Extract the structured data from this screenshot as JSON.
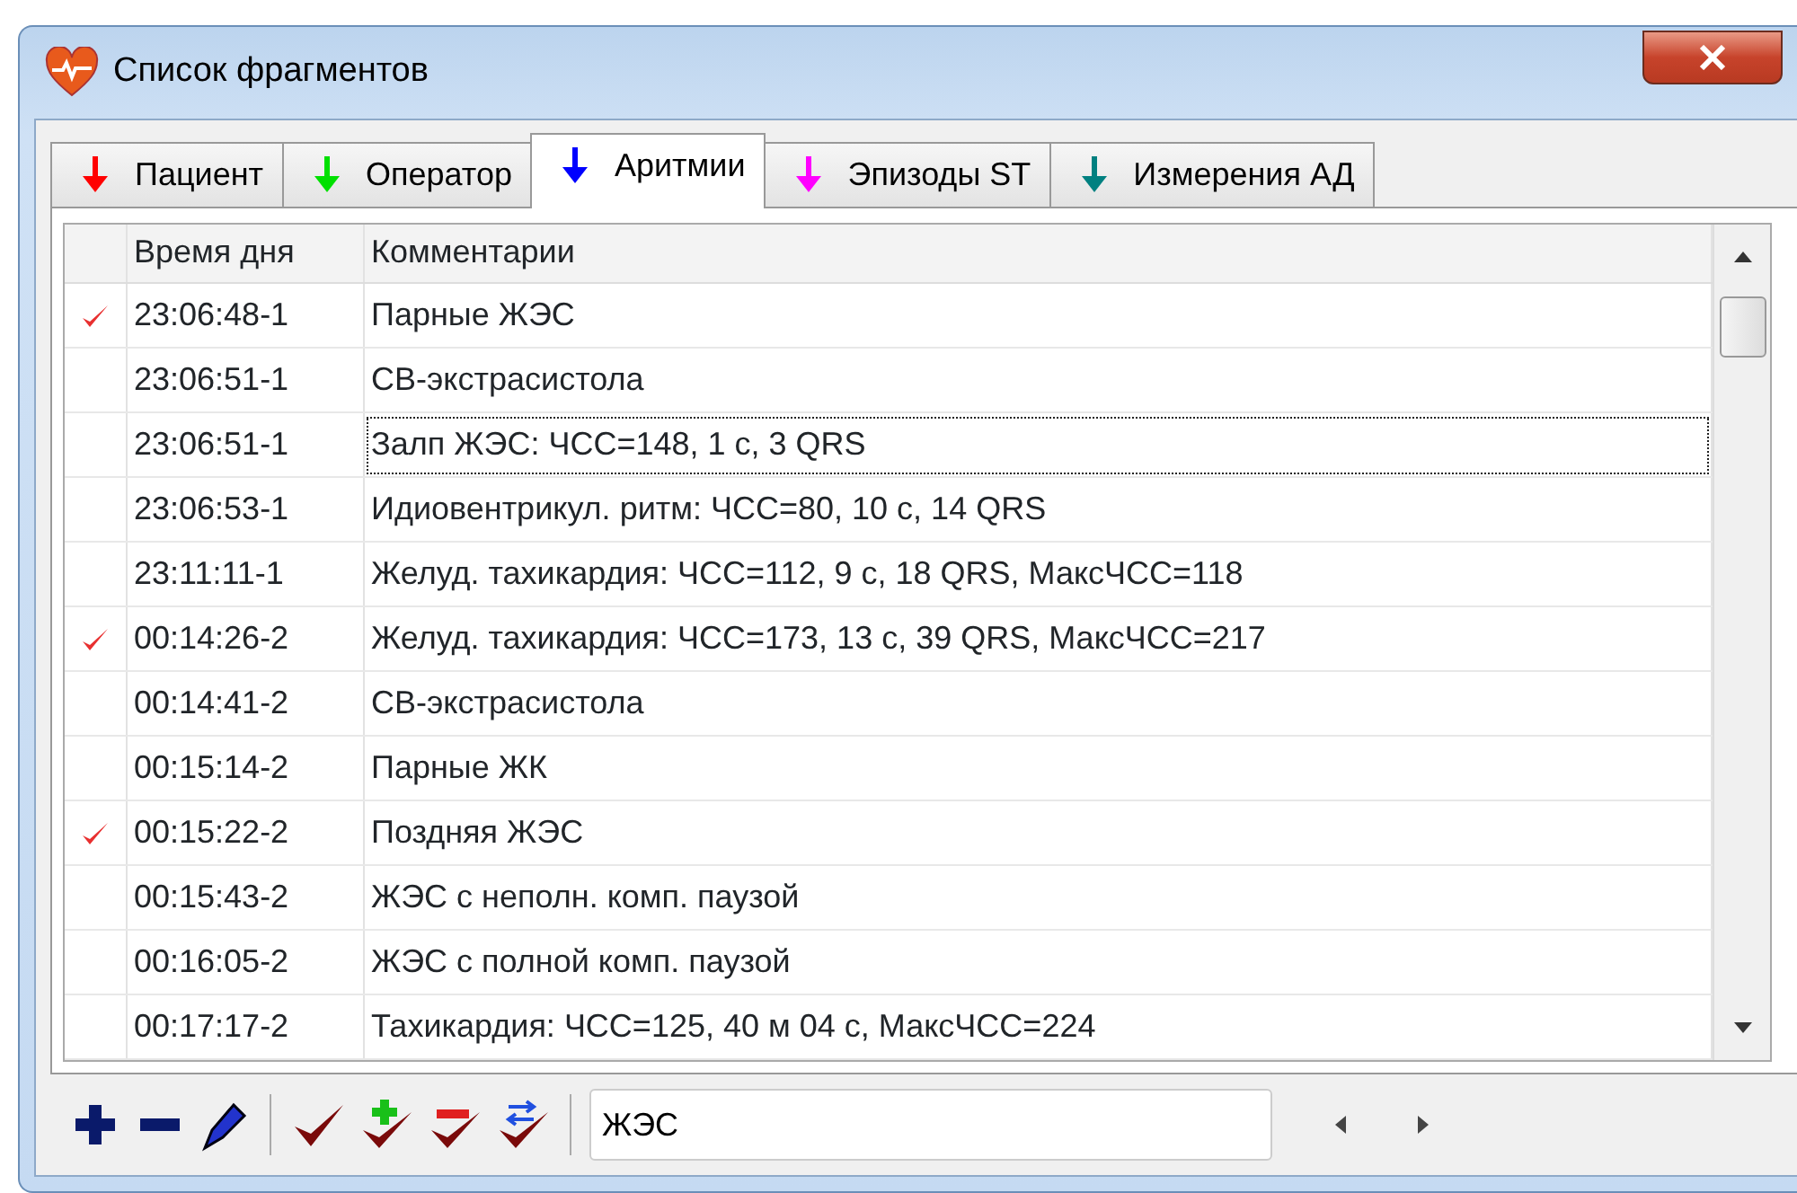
{
  "window": {
    "title": "Список фрагментов"
  },
  "tabs": [
    {
      "label": "Пациент",
      "color": "#ff0000",
      "selected": false
    },
    {
      "label": "Оператор",
      "color": "#00e000",
      "selected": false
    },
    {
      "label": "Аритмии",
      "color": "#0000ff",
      "selected": true
    },
    {
      "label": "Эпизоды ST",
      "color": "#ff00ff",
      "selected": false
    },
    {
      "label": "Измерения АД",
      "color": "#008080",
      "selected": false
    }
  ],
  "table": {
    "columns": [
      "Время дня",
      "Комментарии"
    ],
    "rows": [
      {
        "checked": true,
        "focused": false,
        "time": "23:06:48-1",
        "comment": "Парные ЖЭС"
      },
      {
        "checked": false,
        "focused": false,
        "time": "23:06:51-1",
        "comment": "СВ-экстрасистола"
      },
      {
        "checked": false,
        "focused": true,
        "time": "23:06:51-1",
        "comment": "Залп ЖЭС: ЧСС=148, 1 с, 3 QRS"
      },
      {
        "checked": false,
        "focused": false,
        "time": "23:06:53-1",
        "comment": "Идиовентрикул. ритм: ЧСС=80, 10 с, 14 QRS"
      },
      {
        "checked": false,
        "focused": false,
        "time": "23:11:11-1",
        "comment": "Желуд. тахикардия: ЧСС=112, 9 с, 18 QRS, МаксЧСС=118"
      },
      {
        "checked": true,
        "focused": false,
        "time": "00:14:26-2",
        "comment": "Желуд. тахикардия: ЧСС=173, 13 с, 39 QRS, МаксЧСС=217"
      },
      {
        "checked": false,
        "focused": false,
        "time": "00:14:41-2",
        "comment": "СВ-экстрасистола"
      },
      {
        "checked": false,
        "focused": false,
        "time": "00:15:14-2",
        "comment": "Парные ЖК"
      },
      {
        "checked": true,
        "focused": false,
        "time": "00:15:22-2",
        "comment": "Поздняя ЖЭС"
      },
      {
        "checked": false,
        "focused": false,
        "time": "00:15:43-2",
        "comment": "ЖЭС с неполн. комп. паузой"
      },
      {
        "checked": false,
        "focused": false,
        "time": "00:16:05-2",
        "comment": "ЖЭС с полной комп. паузой"
      },
      {
        "checked": false,
        "focused": false,
        "time": "00:17:17-2",
        "comment": "Тахикардия: ЧСС=125, 40 м 04 с, МаксЧСС=224"
      }
    ]
  },
  "toolbar": {
    "filter_value": "ЖЭС"
  }
}
